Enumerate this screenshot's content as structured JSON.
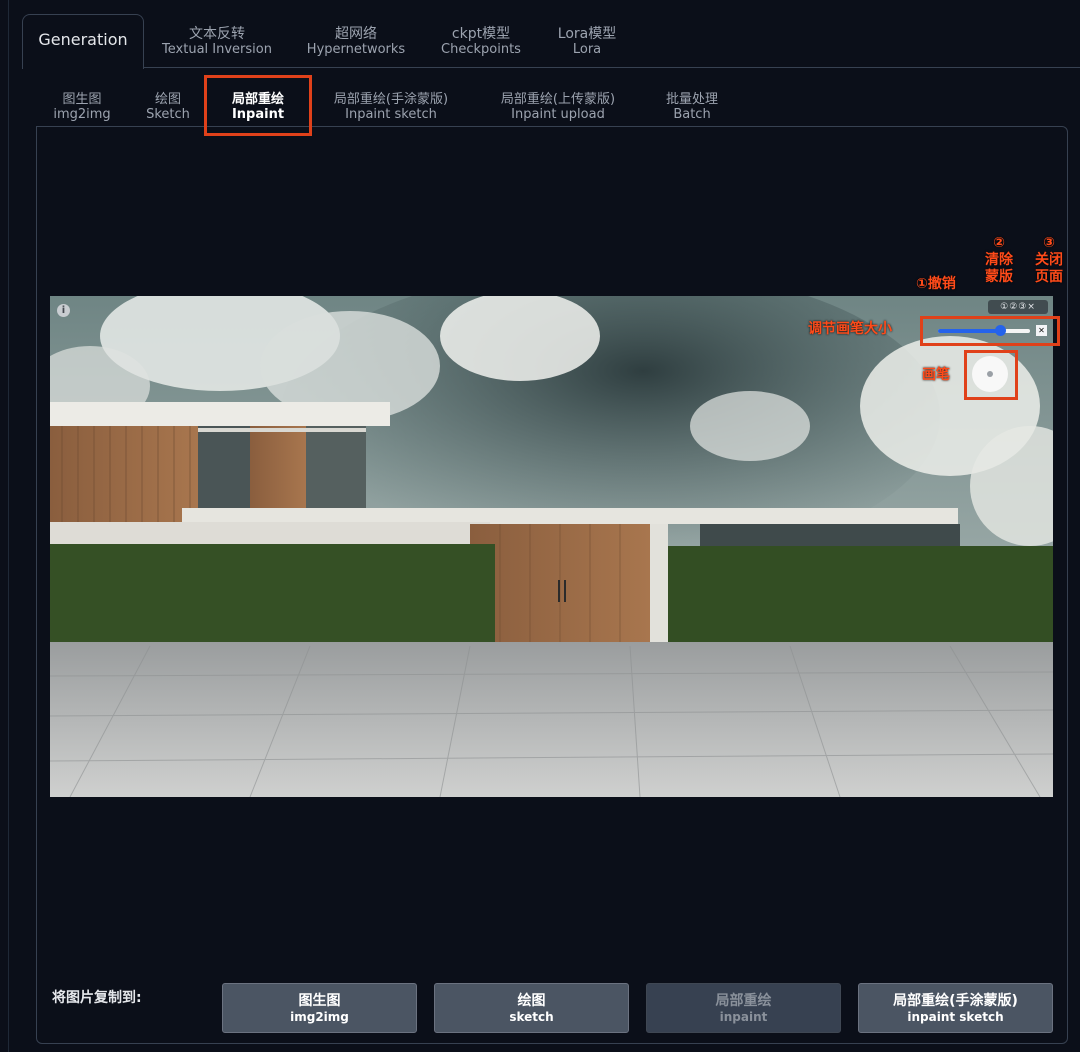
{
  "top_tabs": [
    {
      "label": "Generation",
      "sub": "",
      "active": true
    },
    {
      "label": "文本反转",
      "sub": "Textual Inversion"
    },
    {
      "label": "超网络",
      "sub": "Hypernetworks"
    },
    {
      "label": "ckpt模型",
      "sub": "Checkpoints"
    },
    {
      "label": "Lora模型",
      "sub": "Lora"
    }
  ],
  "sub_tabs": [
    {
      "label": "图生图",
      "sub": "img2img"
    },
    {
      "label": "绘图",
      "sub": "Sketch"
    },
    {
      "label": "局部重绘",
      "sub": "Inpaint",
      "active": true
    },
    {
      "label": "局部重绘(手涂蒙版)",
      "sub": "Inpaint sketch"
    },
    {
      "label": "局部重绘(上传蒙版)",
      "sub": "Inpaint upload"
    },
    {
      "label": "批量处理",
      "sub": "Batch"
    }
  ],
  "canvas": {
    "info_icon": "i",
    "controls_text": "①②③×",
    "close_glyph": "✕",
    "brush_slider_fraction": 0.67
  },
  "annotations": {
    "undo": "①撤销",
    "clear": [
      "②",
      "清除",
      "蒙版"
    ],
    "close": [
      "③",
      "关闭",
      "页面"
    ],
    "adjust": "调节画笔大小",
    "brush": "画笔"
  },
  "copy_to": {
    "label": "将图片复制到:",
    "buttons": [
      {
        "label": "图生图",
        "sub": "img2img",
        "enabled": true
      },
      {
        "label": "绘图",
        "sub": "sketch",
        "enabled": true
      },
      {
        "label": "局部重绘",
        "sub": "inpaint",
        "enabled": false
      },
      {
        "label": "局部重绘(手涂蒙版)",
        "sub": "inpaint sketch",
        "enabled": true
      }
    ]
  },
  "colors": {
    "accent_annotation": "#ff4b1a",
    "highlight_box": "#e0411a",
    "background": "#0b0f19",
    "slider": "#2563eb"
  }
}
